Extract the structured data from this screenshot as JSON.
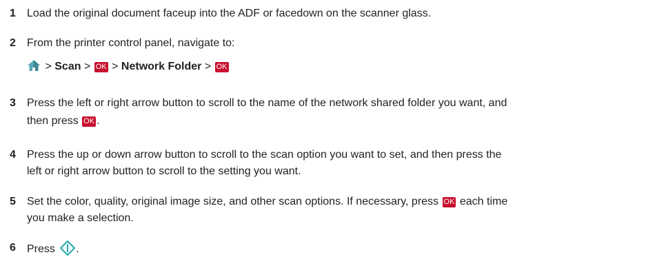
{
  "steps": [
    {
      "num": "1",
      "lines": [
        "Load the original document faceup into the ADF or facedown on the scanner glass."
      ]
    },
    {
      "num": "2",
      "lines": [
        "From the printer control panel, navigate to:"
      ],
      "path": {
        "sep": ">",
        "scan": "Scan",
        "ok": "OK",
        "network_folder": "Network Folder"
      }
    },
    {
      "num": "3",
      "lines": [
        "Press the left or right arrow button to scroll to the name of the network shared folder you want, and",
        "then press",
        "."
      ]
    },
    {
      "num": "4",
      "lines": [
        "Press the up or down arrow button to scroll to the scan option you want to set, and then press the",
        "left or right arrow button to scroll to the setting you want."
      ]
    },
    {
      "num": "5",
      "lines": [
        "Set the color, quality, original image size, and other scan options. If necessary, press",
        "each time",
        "you make a selection."
      ]
    },
    {
      "num": "6",
      "lines": [
        "Press",
        "."
      ]
    }
  ],
  "icons": {
    "home": "home-icon",
    "start": "start-icon",
    "ok_color": "#c8102e",
    "start_color": "#2aa8b0",
    "home_color": "#2aa8b0"
  }
}
